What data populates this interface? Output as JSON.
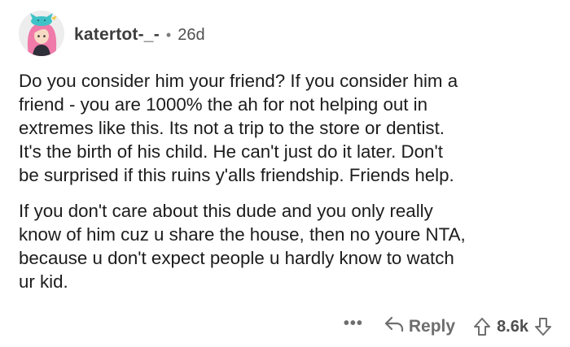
{
  "comment": {
    "author": "katertot-_-",
    "separator": "•",
    "age": "26d",
    "paragraphs": [
      "Do you consider him your friend? If you consider him a\nfriend - you are 1000% the ah for not helping out in\nextremes like this. Its not a trip to the store or dentist.\nIt's the birth of his child. He can't just do it later. Don't\nbe surprised if this ruins y'alls friendship. Friends help.",
      "If you don't care about this dude and you only really\nknow of him cuz u share the house, then no youre NTA,\nbecause u don't expect people u hardly know to watch\nur kid."
    ],
    "avatar_icon": "pink-haired-avatar-with-cat-hat",
    "actions": {
      "more": "•••",
      "reply_label": "Reply",
      "reply_icon": "reply-arrow-icon",
      "upvote_icon": "upvote-arrow-icon",
      "score": "8.6k",
      "downvote_icon": "downvote-arrow-icon"
    }
  },
  "colors": {
    "text": "#1c1c1c",
    "meta": "#6e6e6e",
    "avatar_hair": "#f07aa9",
    "avatar_hat": "#3fc2c7"
  }
}
